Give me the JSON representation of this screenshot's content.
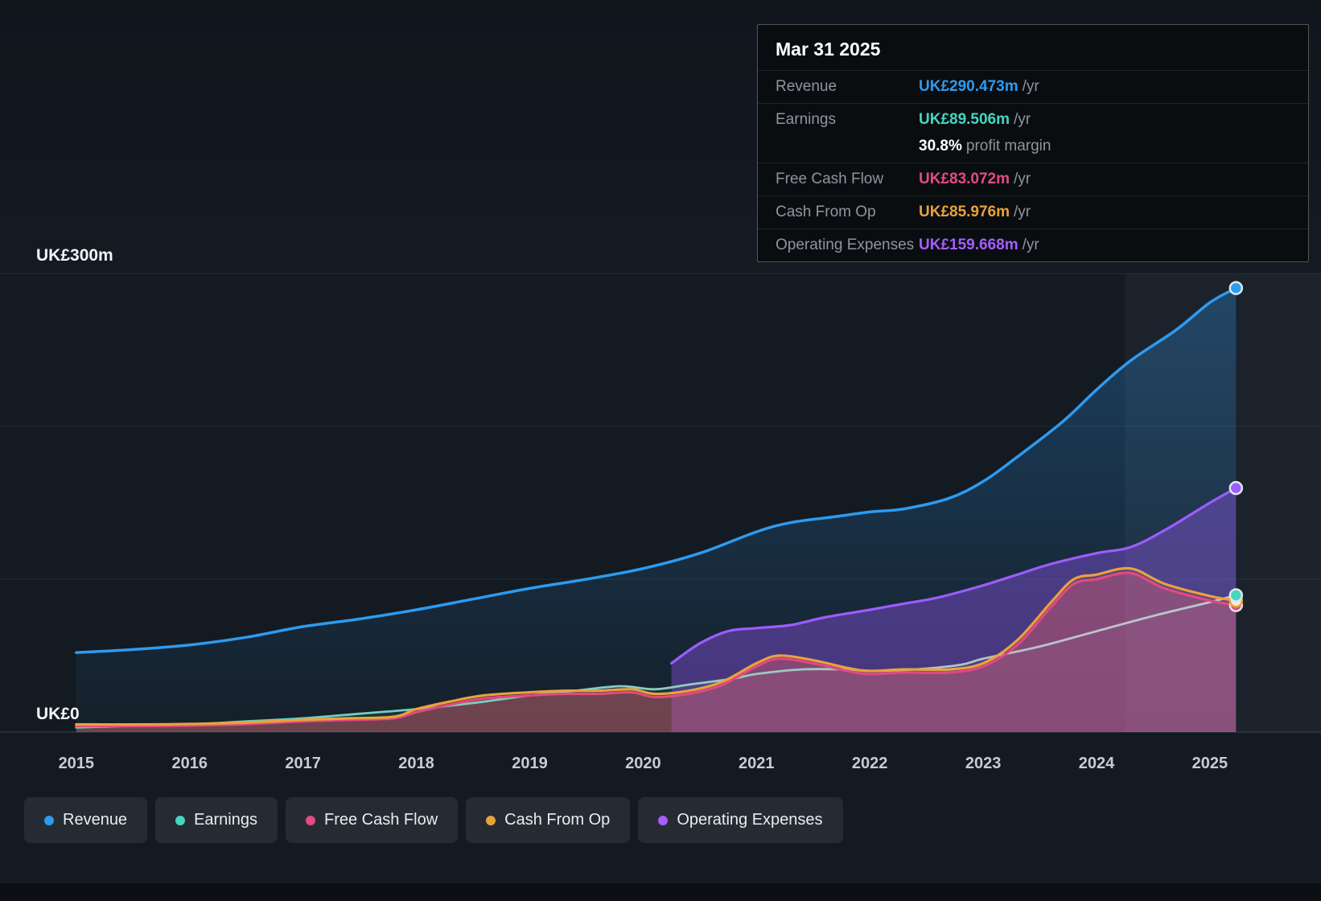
{
  "tooltip": {
    "date": "Mar 31 2025",
    "rows": [
      {
        "label": "Revenue",
        "value": "UK£290.473m",
        "suffix": " /yr",
        "color": "#2d9bf0"
      },
      {
        "label": "Earnings",
        "value": "UK£89.506m",
        "suffix": " /yr",
        "color": "#45d6c0"
      },
      {
        "label": "",
        "value": "30.8%",
        "suffix": " profit margin",
        "color": "#ffffff",
        "sub": true
      },
      {
        "label": "Free Cash Flow",
        "value": "UK£83.072m",
        "suffix": " /yr",
        "color": "#e24c84"
      },
      {
        "label": "Cash From Op",
        "value": "UK£85.976m",
        "suffix": " /yr",
        "color": "#e9a23c"
      },
      {
        "label": "Operating Expenses",
        "value": "UK£159.668m",
        "suffix": " /yr",
        "color": "#a55eff"
      }
    ]
  },
  "legend": {
    "items": [
      {
        "label": "Revenue",
        "color": "#2d9bf0"
      },
      {
        "label": "Earnings",
        "color": "#45d6c0"
      },
      {
        "label": "Free Cash Flow",
        "color": "#e24c84"
      },
      {
        "label": "Cash From Op",
        "color": "#e9a23c"
      },
      {
        "label": "Operating Expenses",
        "color": "#a55eff"
      }
    ]
  },
  "chart_data": {
    "type": "area-line",
    "title": "Earnings and Revenue History",
    "unit": "UK£m",
    "xlim": [
      2014.54,
      2025.98
    ],
    "ylim": [
      0,
      300
    ],
    "y_gridlines": [
      0,
      100,
      200,
      300
    ],
    "y_axis_labels": [
      {
        "value": 300,
        "label": "UK£300m"
      },
      {
        "value": 0,
        "label": "UK£0"
      }
    ],
    "x_ticks": [
      2015,
      2016,
      2017,
      2018,
      2019,
      2020,
      2021,
      2022,
      2023,
      2024,
      2025
    ],
    "highlight_band": {
      "from": 2024.25,
      "to": 2025.98
    },
    "grid": true,
    "legend_position": "bottom",
    "series": [
      {
        "name": "Revenue",
        "color": "#2d9bf0",
        "fill_color": "gradient-blue",
        "line_width": 3.5,
        "marker": "solid",
        "x": [
          2015,
          2015.5,
          2016,
          2016.5,
          2017,
          2017.5,
          2018,
          2018.5,
          2019,
          2019.5,
          2020,
          2020.5,
          2021,
          2021.3,
          2021.7,
          2022,
          2022.3,
          2022.7,
          2023,
          2023.3,
          2023.7,
          2024,
          2024.3,
          2024.7,
          2025,
          2025.23
        ],
        "values": [
          52,
          54,
          57,
          62,
          69,
          74,
          80,
          87,
          94,
          100,
          107,
          117,
          131,
          137,
          141,
          144,
          146,
          153,
          164,
          180,
          203,
          224,
          243,
          263,
          281,
          290.473
        ]
      },
      {
        "name": "Earnings",
        "color": "#45d6c0",
        "fill_color": "rgba(110,200,185,0.10)",
        "line_width": 2.8,
        "marker": "solid",
        "x": [
          2015,
          2015.5,
          2016,
          2016.5,
          2017,
          2017.5,
          2018,
          2018.5,
          2019,
          2019.4,
          2019.8,
          2020.1,
          2020.4,
          2020.8,
          2021,
          2021.4,
          2021.8,
          2022,
          2022.4,
          2022.8,
          2023,
          2023.5,
          2024,
          2024.5,
          2025,
          2025.23
        ],
        "values": [
          3,
          4,
          5,
          7,
          9,
          12,
          15,
          19,
          24,
          27,
          30,
          28,
          31,
          35,
          38,
          41,
          41,
          40,
          41,
          44,
          48,
          56,
          66,
          76,
          85,
          89.506
        ]
      },
      {
        "name": "Free Cash Flow",
        "color": "#e2497f",
        "fill_color": "rgba(205,73,120,0.38)",
        "line_width": 3.2,
        "marker": "solid",
        "x": [
          2015,
          2015.7,
          2016.4,
          2017,
          2017.4,
          2017.8,
          2018,
          2018.3,
          2018.6,
          2019,
          2019.3,
          2019.6,
          2019.9,
          2020.1,
          2020.4,
          2020.7,
          2021,
          2021.2,
          2021.5,
          2021.8,
          2022,
          2022.3,
          2022.7,
          2023,
          2023.3,
          2023.6,
          2023.8,
          2024,
          2024.3,
          2024.6,
          2025,
          2025.23
        ],
        "values": [
          4,
          4,
          5,
          7,
          8,
          9,
          13,
          18,
          22,
          24,
          25,
          25,
          26,
          23,
          25,
          31,
          43,
          48,
          45,
          40,
          38,
          39,
          39,
          43,
          57,
          82,
          97,
          100,
          104,
          94,
          86,
          83.072
        ]
      },
      {
        "name": "Cash From Op",
        "color": "#e9a23c",
        "fill_color": "rgba(233,161,59,0.10)",
        "line_width": 3.2,
        "marker": "hollow",
        "x": [
          2015,
          2015.7,
          2016.4,
          2017,
          2017.4,
          2017.8,
          2018,
          2018.3,
          2018.6,
          2019,
          2019.3,
          2019.6,
          2019.9,
          2020.1,
          2020.4,
          2020.7,
          2021,
          2021.2,
          2021.5,
          2021.8,
          2022,
          2022.3,
          2022.7,
          2023,
          2023.3,
          2023.6,
          2023.8,
          2024,
          2024.3,
          2024.6,
          2025,
          2025.23
        ],
        "values": [
          5,
          5,
          6,
          8,
          9,
          10,
          15,
          20,
          24,
          26,
          27,
          27,
          28,
          25,
          27,
          33,
          45,
          50,
          47,
          42,
          40,
          41,
          41,
          45,
          60,
          85,
          100,
          103,
          107,
          97,
          89,
          85.976
        ]
      },
      {
        "name": "Operating Expenses",
        "color": "#9d5cff",
        "fill_color": "rgba(143,84,233,0.42)",
        "line_width": 3.2,
        "marker": "solid",
        "x": [
          2020.25,
          2020.5,
          2020.75,
          2021,
          2021.3,
          2021.6,
          2022,
          2022.3,
          2022.6,
          2023,
          2023.3,
          2023.6,
          2024,
          2024.3,
          2024.6,
          2025,
          2025.23
        ],
        "values": [
          45,
          58,
          66,
          68,
          70,
          75,
          80,
          84,
          88,
          96,
          103,
          110,
          117,
          121,
          132,
          150,
          159.668
        ]
      }
    ]
  }
}
